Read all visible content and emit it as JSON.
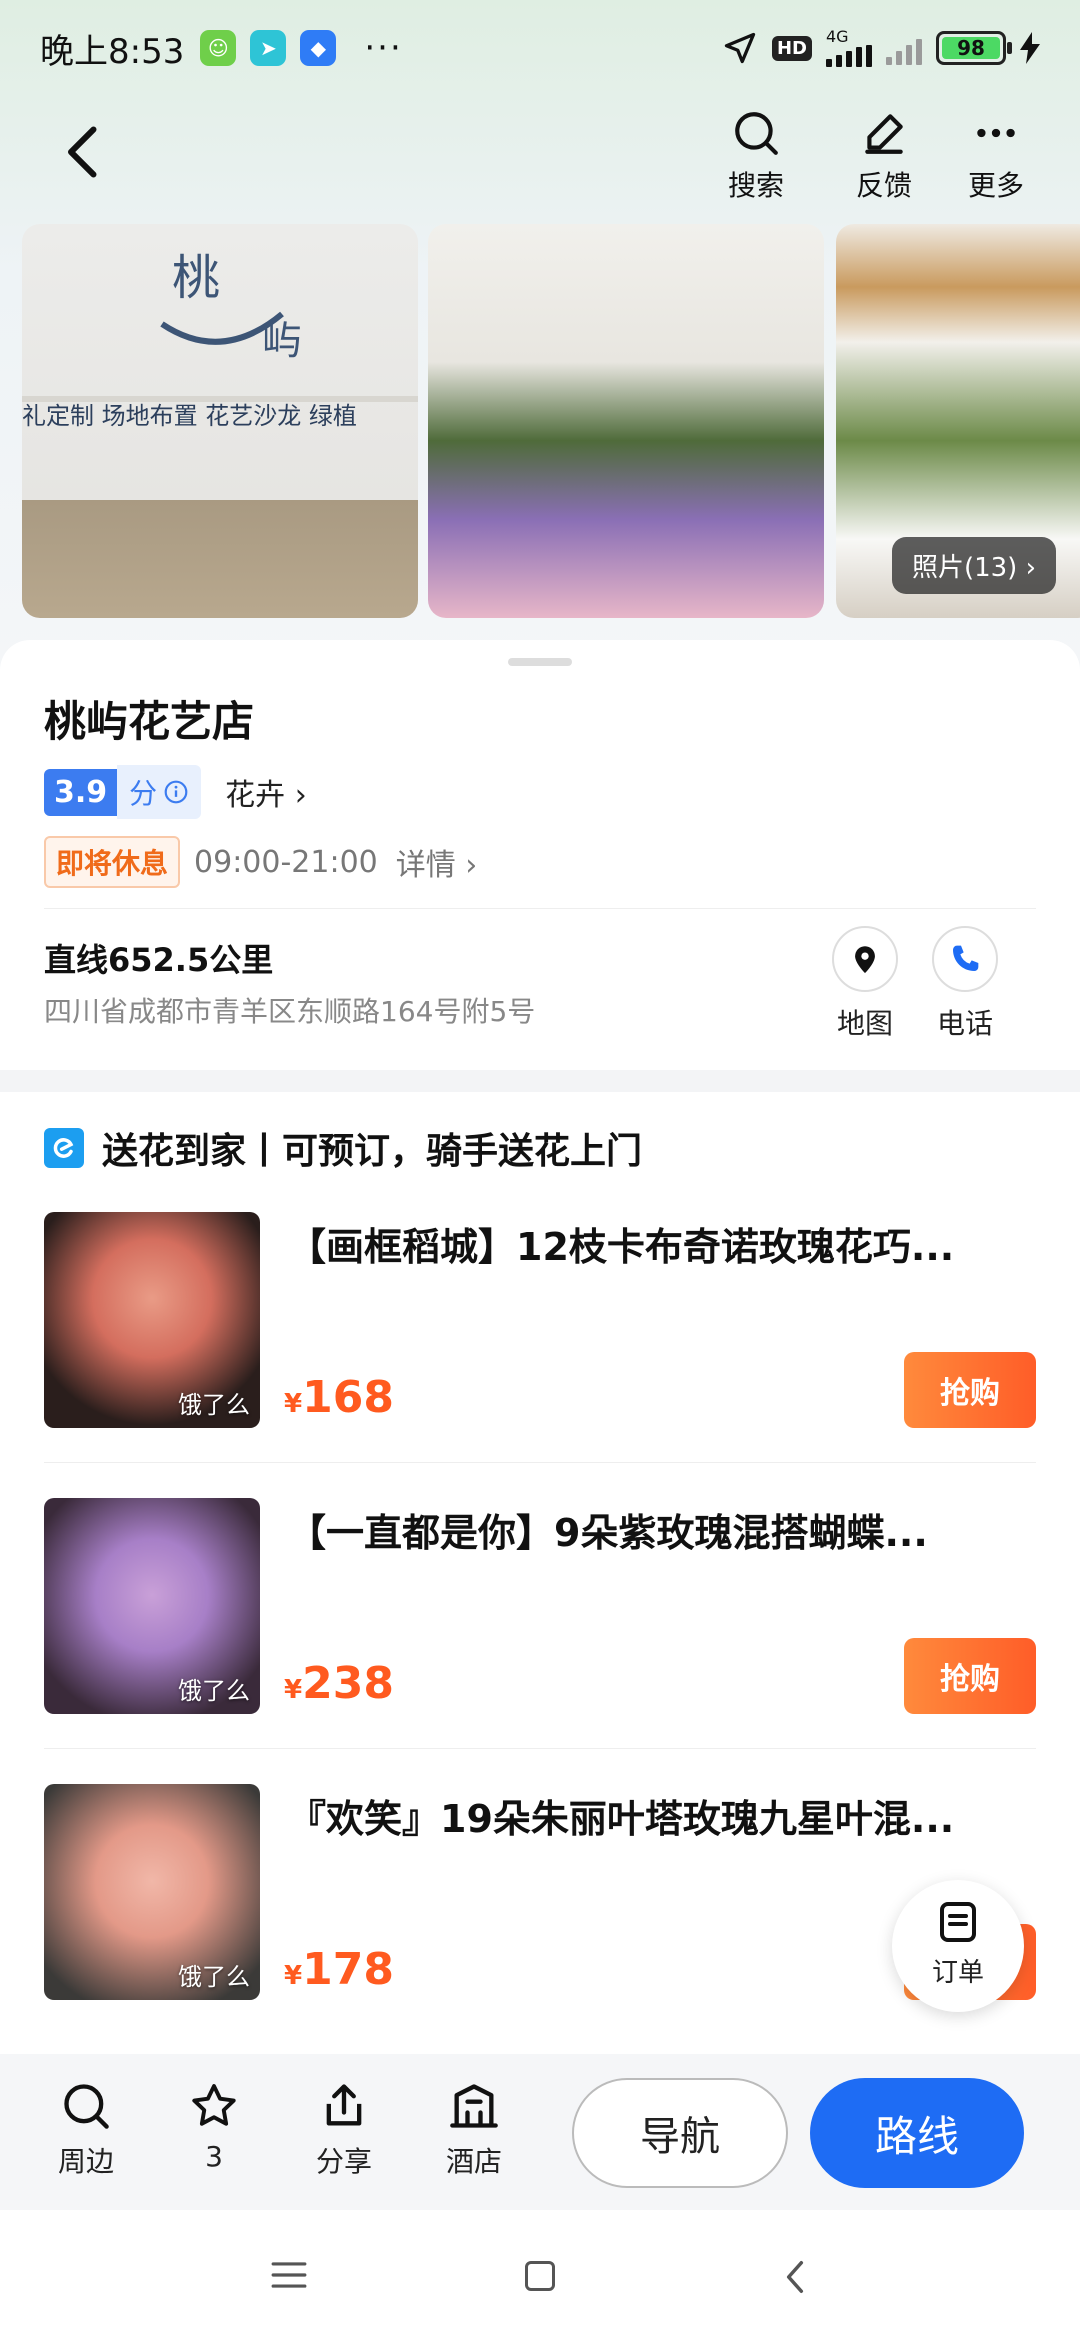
{
  "status_bar": {
    "time": "晚上8:53",
    "more": "···",
    "network": "4G",
    "hd": "HD",
    "battery": "98"
  },
  "header": {
    "back_icon": "chevron-left-icon",
    "actions": [
      {
        "label": "搜索",
        "icon": "search-icon"
      },
      {
        "label": "反馈",
        "icon": "edit-icon"
      },
      {
        "label": "更多",
        "icon": "more-icon"
      }
    ]
  },
  "photos": {
    "count_label": "照片(13)"
  },
  "shop": {
    "name": "桃屿花艺店",
    "score": "3.9",
    "score_unit": "分",
    "category": "花卉",
    "status": "即将休息",
    "hours": "09:00-21:00",
    "details": "详情",
    "distance": "直线652.5公里",
    "address": "四川省成都市青羊区东顺路164号附5号",
    "map_label": "地图",
    "phone_label": "电话"
  },
  "delivery": {
    "title": "送花到家丨可预订，骑手送花上门",
    "products": [
      {
        "title": "【画框稻城】12枝卡布奇诺玫瑰花巧...",
        "price_symbol": "¥",
        "price": "168",
        "tag": "饿了么",
        "button": "抢购"
      },
      {
        "title": "【一直都是你】9朵紫玫瑰混搭蝴蝶...",
        "price_symbol": "¥",
        "price": "238",
        "tag": "饿了么",
        "button": "抢购"
      },
      {
        "title": "『欢笑』19朵朱丽叶塔玫瑰九星叶混...",
        "price_symbol": "¥",
        "price": "178",
        "tag": "饿了么",
        "button": "抢购"
      }
    ]
  },
  "order_fab": {
    "label": "订单"
  },
  "bottom_bar": {
    "tools": [
      {
        "label": "周边",
        "icon": "search-icon"
      },
      {
        "label": "3",
        "icon": "star-icon"
      },
      {
        "label": "分享",
        "icon": "share-icon"
      },
      {
        "label": "酒店",
        "icon": "hotel-icon"
      }
    ],
    "navigate": "导航",
    "route": "路线"
  },
  "colors": {
    "accent_blue": "#1e6cf4",
    "price_orange": "#ff5a1f",
    "score_blue": "#3c7cf0"
  }
}
